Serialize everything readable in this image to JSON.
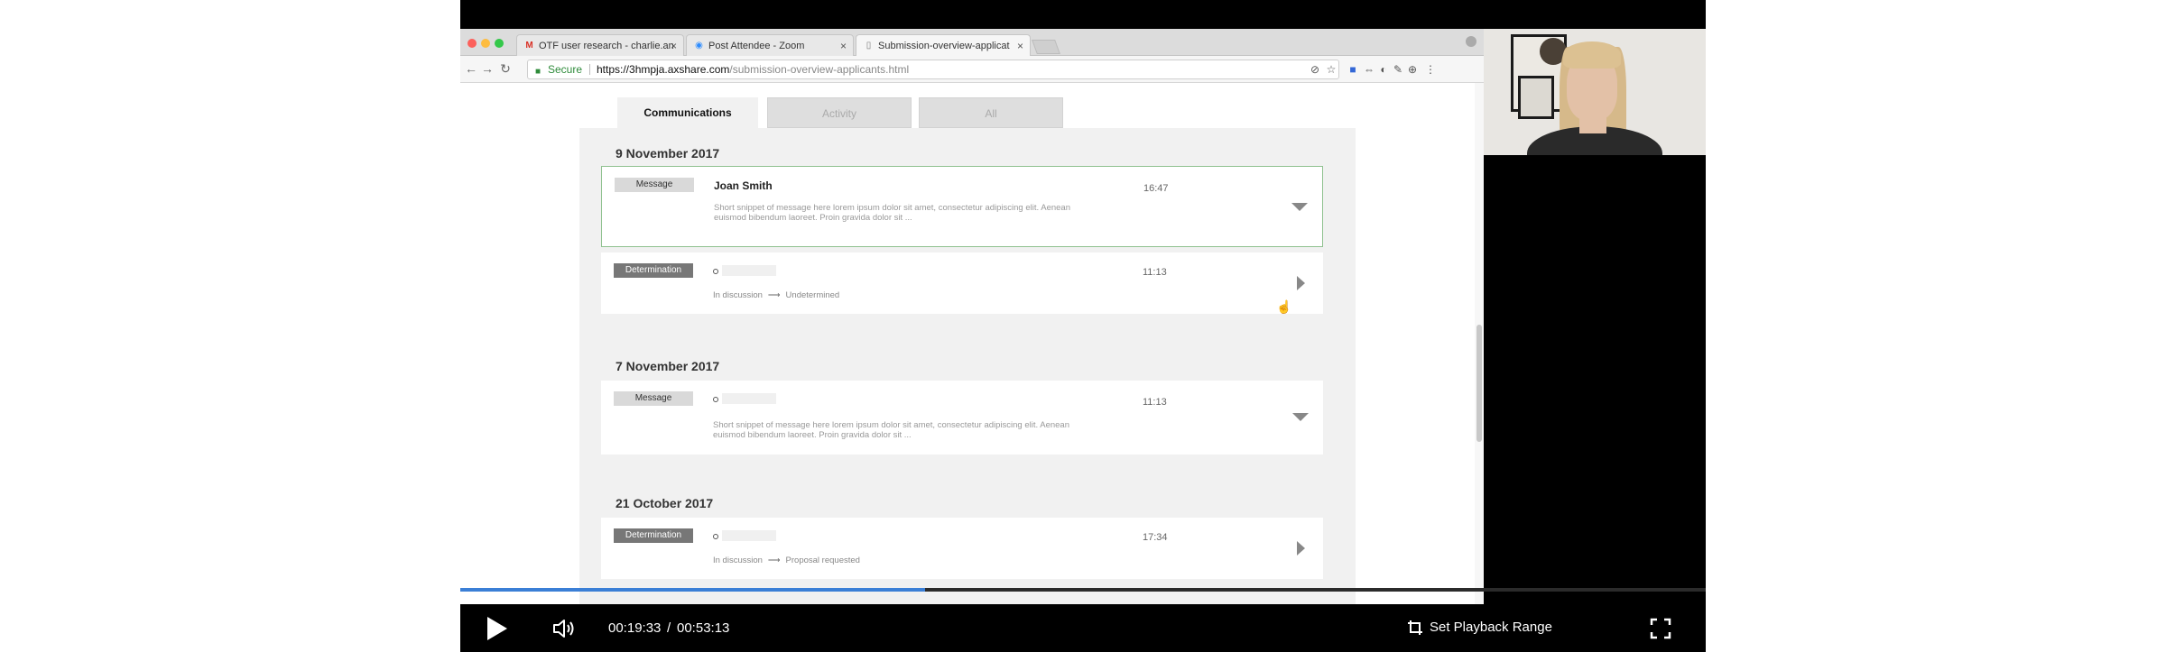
{
  "browser": {
    "tabs": [
      {
        "label": "OTF user research - charlie.an",
        "icon": "gmail-icon"
      },
      {
        "label": "Post Attendee - Zoom",
        "icon": "zoom-icon"
      },
      {
        "label": "Submission-overview-applicat",
        "icon": "page-icon"
      }
    ],
    "active_tab_index": 2,
    "secure_label": "Secure",
    "url_host": "https://3hmpja.axshare.com",
    "url_path": "/submission-overview-applicants.html"
  },
  "page": {
    "tabs": [
      {
        "label": "Communications",
        "active": true
      },
      {
        "label": "Activity",
        "active": false
      },
      {
        "label": "All",
        "active": false
      }
    ],
    "groups": [
      {
        "date": "9 November 2017",
        "items": [
          {
            "type": "Message",
            "sender": "Joan Smith",
            "time": "16:47",
            "snippet": "Short snippet of message here lorem ipsum dolor sit amet, consectetur adipiscing elit. Aenean euismod bibendum laoreet. Proin gravida dolor sit ...",
            "selected": true
          },
          {
            "type": "Determination",
            "time": "11:13",
            "status_from": "In discussion",
            "status_to": "Undetermined"
          }
        ]
      },
      {
        "date": "7 November 2017",
        "items": [
          {
            "type": "Message",
            "time": "11:13",
            "snippet": "Short snippet of message here lorem ipsum dolor sit amet, consectetur adipiscing elit. Aenean euismod bibendum laoreet. Proin gravida dolor sit ..."
          }
        ]
      },
      {
        "date": "21 October 2017",
        "items": [
          {
            "type": "Determination",
            "time": "17:34",
            "status_from": "In discussion",
            "status_to": "Proposal requested"
          }
        ]
      }
    ]
  },
  "player": {
    "current_time": "00:19:33",
    "separator": "/",
    "total_time": "00:53:13",
    "progress_fraction": 0.373,
    "range_label": "Set Playback Range",
    "accent_color": "#3b7fd6"
  }
}
